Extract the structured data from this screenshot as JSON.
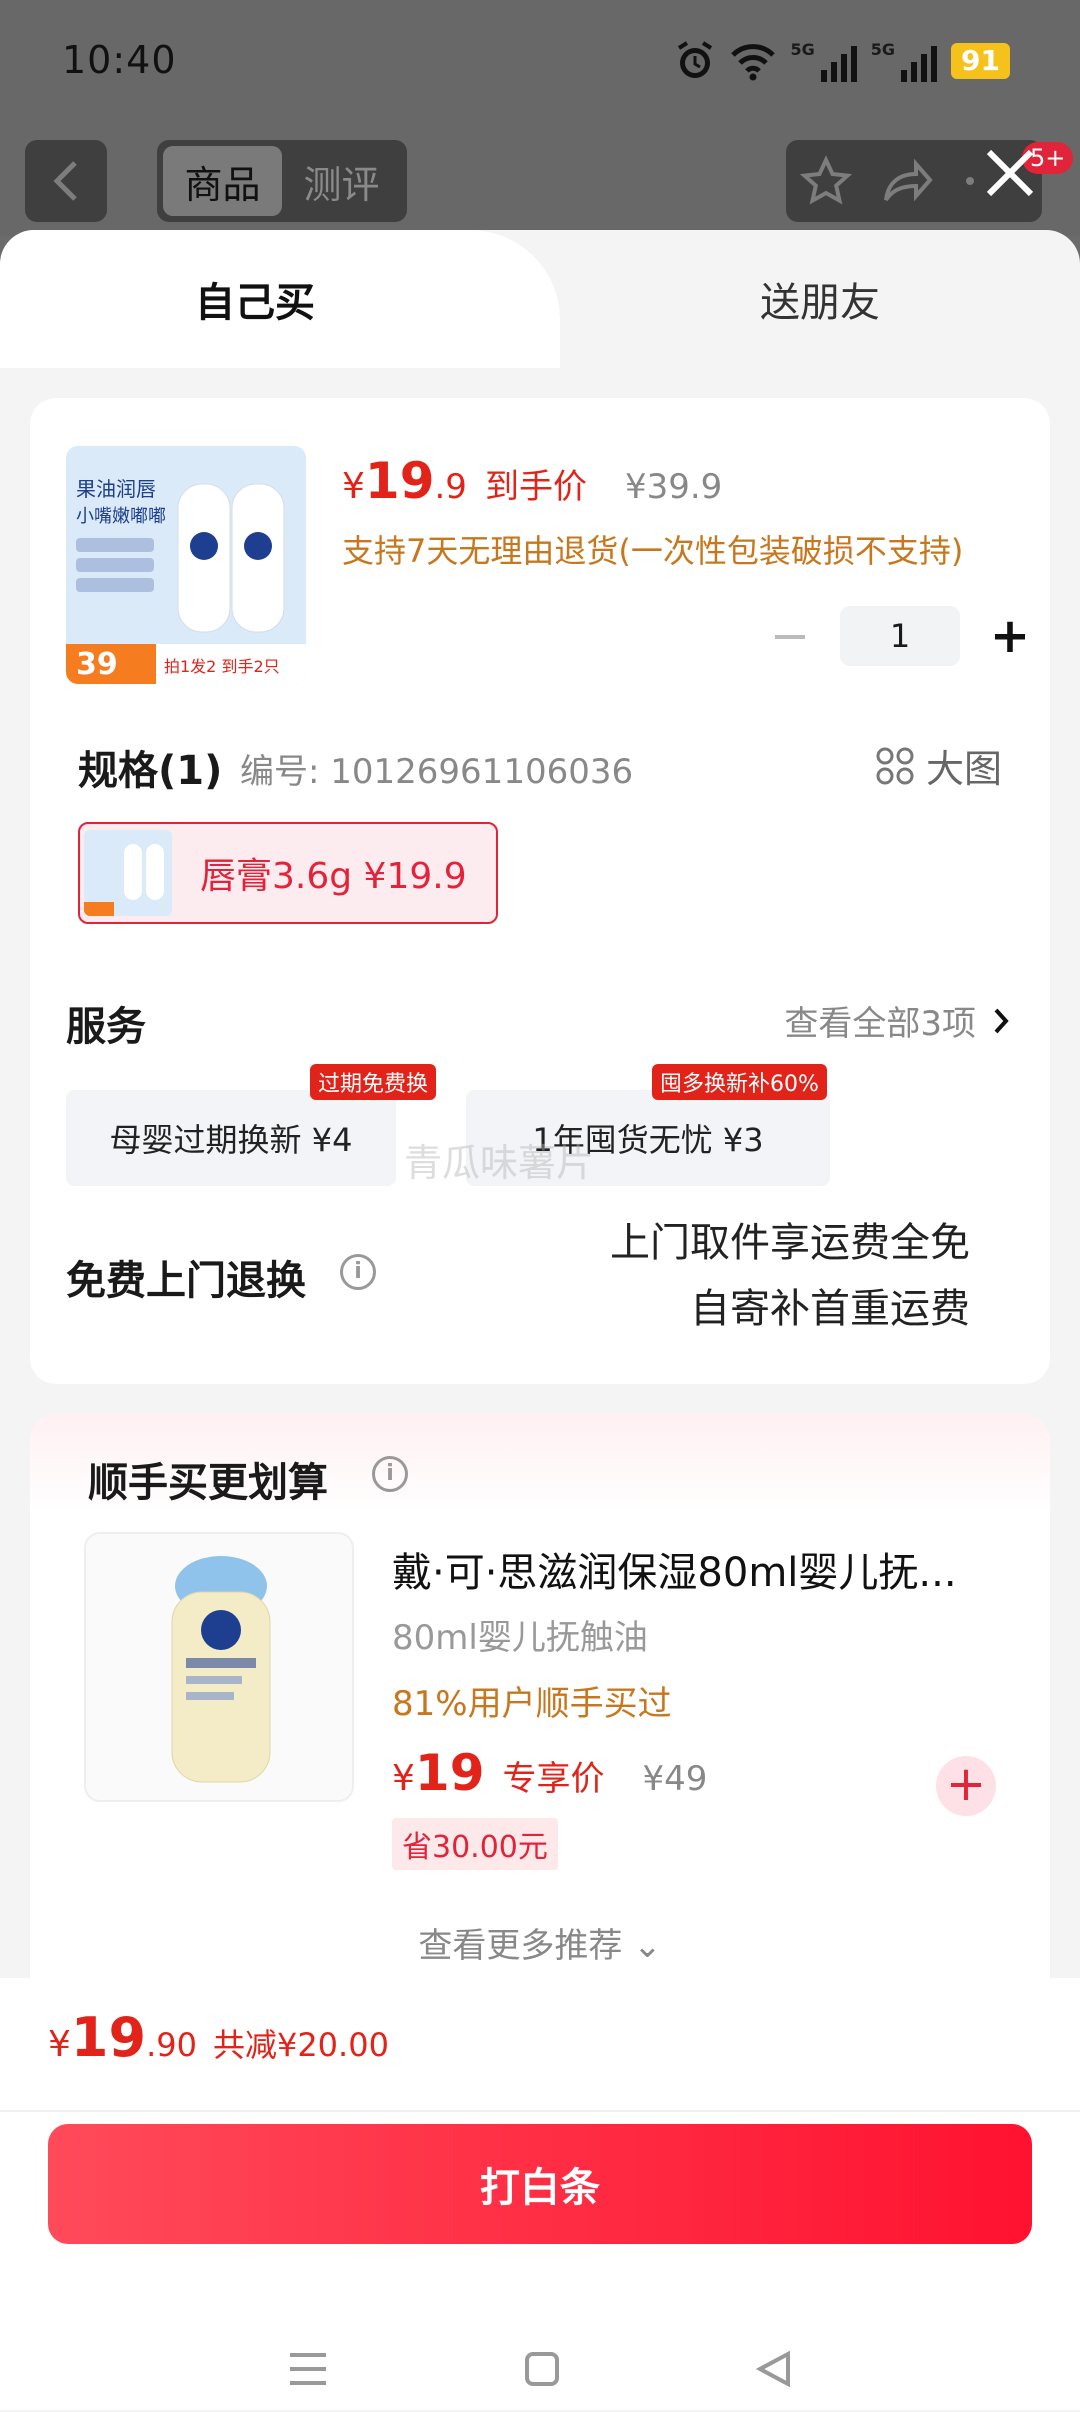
{
  "status_bar": {
    "time": "10:40",
    "battery": "91",
    "net1": "5G",
    "net2": "5G"
  },
  "nav": {
    "seg_product": "商品",
    "seg_review": "测评",
    "badge": "5+"
  },
  "tabs": {
    "self": "自己买",
    "gift": "送朋友"
  },
  "product": {
    "thumb_title": "果油润唇\n小嘴嫩嘟嘟",
    "thumb_price": "39",
    "thumb_banner": "拍1发2 到手2只",
    "price_yen": "¥",
    "price_int": "19",
    "price_dec": ".9",
    "price_label": "到手价",
    "orig_price": "¥39.9",
    "return_note": "支持7天无理由退货(一次性包装破损不支持)",
    "qty": "1"
  },
  "spec": {
    "title": "规格(1)",
    "code": "编号: 10126961106036",
    "big_image": "大图",
    "chip_label": "唇膏3.6g  ¥19.9"
  },
  "service": {
    "title": "服务",
    "view_all": "查看全部3项",
    "items": [
      {
        "label": "母婴过期换新  ¥4",
        "tag": "过期免费换"
      },
      {
        "label": "1年囤货无忧  ¥3",
        "tag": "囤多换新补60%"
      }
    ],
    "watermark": "青瓜味薯片"
  },
  "free_return": {
    "title": "免费上门退换",
    "line1": "上门取件享运费全免",
    "line2": "自寄补首重运费"
  },
  "recommend": {
    "title": "顺手买更划算",
    "name": "戴·可·思滋润保湿80ml婴儿抚...",
    "spec": "80ml婴儿抚触油",
    "percent": "81%用户顺手买过",
    "price_yen": "¥",
    "price": "19",
    "price_label": "专享价",
    "orig_price": "¥49",
    "save": "省30.00元",
    "more": "查看更多推荐 ⌄"
  },
  "footer": {
    "total_yen": "¥",
    "total_int": "19",
    "total_dec": ".90",
    "discount": "共减¥20.00",
    "pay_button": "打白条"
  },
  "colors": {
    "accent": "#e2231a",
    "orange": "#c7771e",
    "button": "#ff1f3d"
  }
}
